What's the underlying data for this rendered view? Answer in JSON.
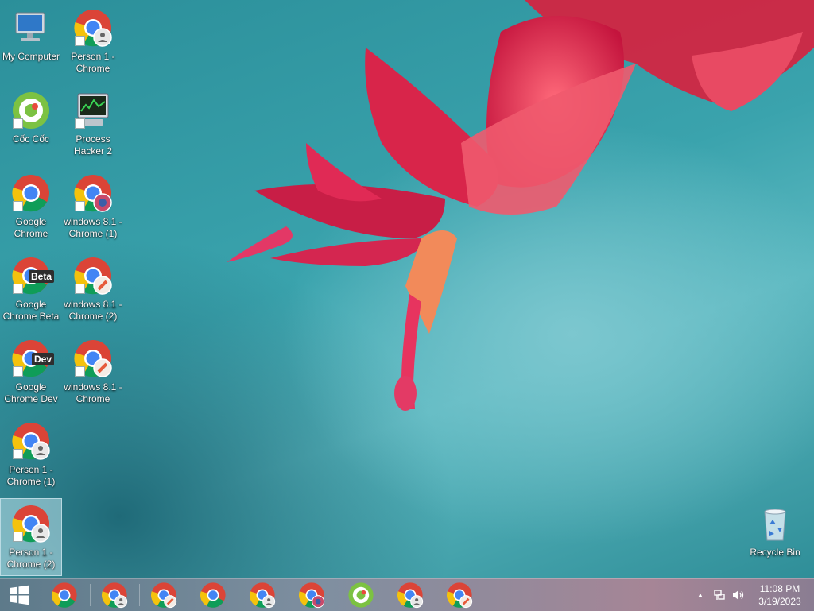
{
  "desktop": {
    "icons": [
      {
        "label": "My Computer",
        "kind": "computer"
      },
      {
        "label": "Person 1 - Chrome",
        "kind": "chrome-person"
      },
      {
        "label": "Cốc Cốc",
        "kind": "coccoc"
      },
      {
        "label": "Process Hacker 2",
        "kind": "processhacker"
      },
      {
        "label": "Google Chrome",
        "kind": "chrome"
      },
      {
        "label": "windows 8.1 - Chrome (1)",
        "kind": "chrome-profile"
      },
      {
        "label": "Google Chrome Beta",
        "kind": "chrome-beta",
        "tag": "Beta"
      },
      {
        "label": "windows 8.1 - Chrome (2)",
        "kind": "chrome-profile2"
      },
      {
        "label": "Google Chrome Dev",
        "kind": "chrome-dev",
        "tag": "Dev"
      },
      {
        "label": "windows 8.1 - Chrome",
        "kind": "chrome-profile2"
      },
      {
        "label": "Person 1 - Chrome (1)",
        "kind": "chrome-person"
      },
      {
        "label": "Person 1 - Chrome (2)",
        "kind": "chrome-person",
        "selected": true
      },
      {
        "label": "Recycle Bin",
        "kind": "recyclebin"
      }
    ]
  },
  "taskbar": {
    "pinned": [
      {
        "name": "chrome",
        "icon": "chrome-icon"
      },
      {
        "name": "person-chrome",
        "icon": "chrome-person-icon"
      },
      {
        "name": "profile-chrome-1",
        "icon": "chrome-profile-icon"
      },
      {
        "name": "chrome-2",
        "icon": "chrome-icon"
      },
      {
        "name": "person-chrome-2",
        "icon": "chrome-person-icon"
      },
      {
        "name": "profile-chrome-2",
        "icon": "chrome-profile-icon"
      },
      {
        "name": "coccoc",
        "icon": "coccoc-icon"
      },
      {
        "name": "person-chrome-3",
        "icon": "chrome-person-icon"
      },
      {
        "name": "profile-chrome-3",
        "icon": "chrome-profile-icon"
      }
    ],
    "tray": {
      "chevron": "▲",
      "network_icon": "network-icon",
      "volume_icon": "volume-icon"
    },
    "clock": {
      "time": "11:08 PM",
      "date": "3/19/2023"
    }
  },
  "colors": {
    "chrome_red": "#db4437",
    "chrome_yellow": "#f4c20d",
    "chrome_green": "#0f9d58",
    "chrome_blue": "#4285f4",
    "coccoc_green": "#7cc242",
    "flower": "#e8335a"
  }
}
